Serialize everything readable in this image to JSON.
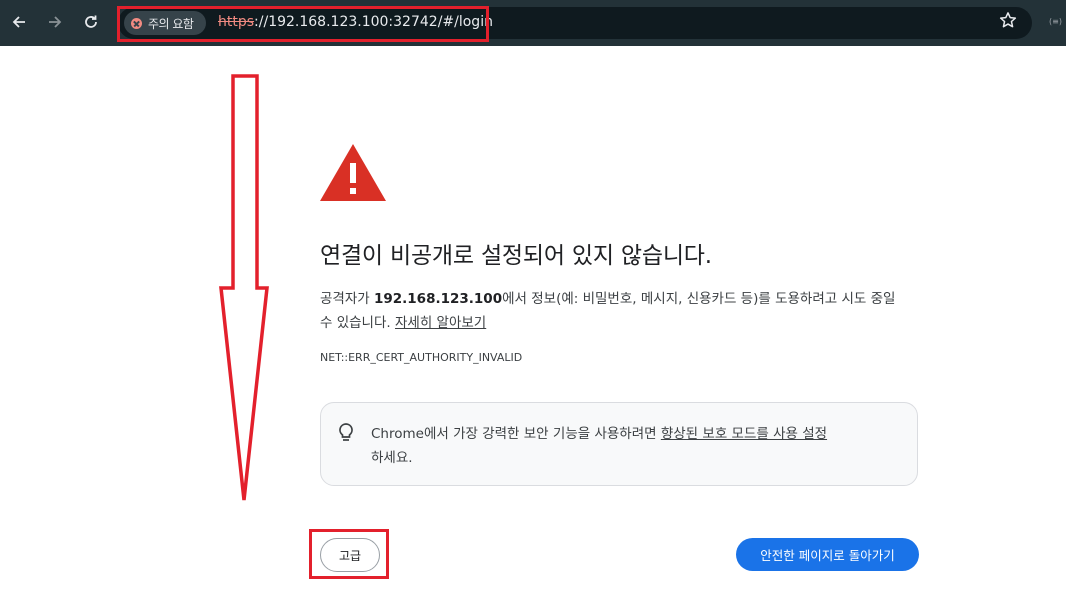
{
  "browser": {
    "security_chip_label": "주의 요함",
    "url_scheme": "https",
    "url_rest": "://192.168.123.100:32742/#/login",
    "icons": [
      "back-arrow-icon",
      "forward-arrow-icon",
      "reload-icon",
      "not-secure-icon",
      "bookmark-star-icon"
    ],
    "extension_label": "(≡)"
  },
  "interstitial": {
    "heading": "연결이 비공개로 설정되어 있지 않습니다.",
    "explanation_prefix": "공격자가 ",
    "explanation_host": "192.168.123.100",
    "explanation_suffix": "에서 정보(예: 비밀번호, 메시지, 신용카드 등)를 도용하려고 시도 중일 수 있습니다. ",
    "learn_more_link": "자세히 알아보기",
    "error_code": "NET::ERR_CERT_AUTHORITY_INVALID",
    "promo_prefix": "Chrome에서 가장 강력한 보안 기능을 사용하려면 ",
    "promo_link": "향상된 보호 모드를 사용 설정",
    "promo_suffix": "하세요.",
    "advanced_button": "고급",
    "back_to_safety_button": "안전한 페이지로 돌아가기"
  },
  "colors": {
    "toolbar_bg": "#233238",
    "warning_red": "#d93025",
    "annotation_red": "#e3202c",
    "primary_blue": "#1a73e8"
  }
}
